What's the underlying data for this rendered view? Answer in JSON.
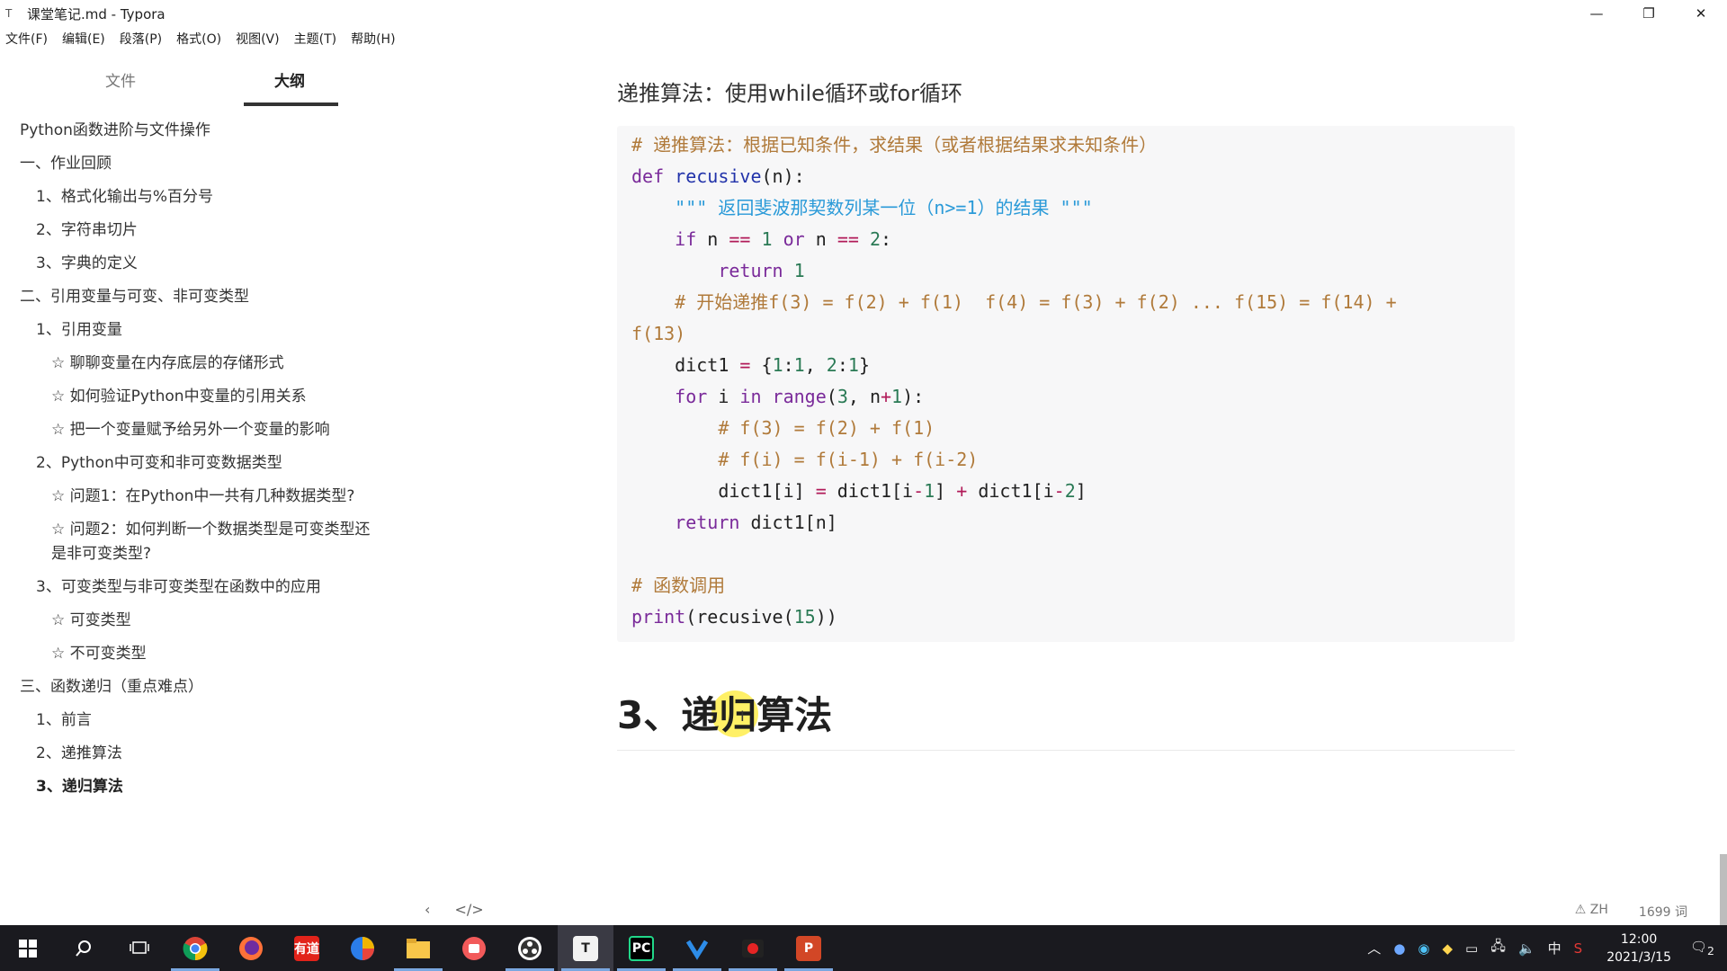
{
  "window": {
    "title": "课堂笔记.md - Typora",
    "app_icon": "T",
    "minimize": "—",
    "restore": "❐",
    "close": "✕"
  },
  "menu": [
    "文件(F)",
    "编辑(E)",
    "段落(P)",
    "格式(O)",
    "视图(V)",
    "主题(T)",
    "帮助(H)"
  ],
  "sidebar": {
    "tab_files": "文件",
    "tab_outline": "大纲",
    "outline": [
      "Python函数进阶与文件操作",
      "一、作业回顾",
      "1、格式化输出与%百分号",
      "2、字符串切片",
      "3、字典的定义",
      "二、引用变量与可变、非可变类型",
      "1、引用变量",
      "☆ 聊聊变量在内存底层的存储形式",
      "☆ 如何验证Python中变量的引用关系",
      "☆ 把一个变量赋予给另外一个变量的影响",
      "2、Python中可变和非可变数据类型",
      "☆ 问题1：在Python中一共有几种数据类型?",
      "☆ 问题2：如何判断一个数据类型是可变类型还是非可变类型?",
      "3、可变类型与非可变类型在函数中的应用",
      "☆ 可变类型",
      "☆ 不可变类型",
      "三、函数递归（重点难点）",
      "1、前言",
      "2、递推算法",
      "3、递归算法"
    ]
  },
  "main": {
    "subheading": "递推算法：使用while循环或for循环",
    "code": {
      "l1": "# 递推算法：根据已知条件，求结果（或者根据结果求未知条件）",
      "l2_kw": "def",
      "l2_fn": "recusive",
      "l2_rest": "(n):",
      "l3": "    \"\"\" 返回斐波那契数列某一位（n>=1）的结果 \"\"\"",
      "l4_indent": "    ",
      "l4_kw": "if",
      "l4_a": " n ",
      "l4_op1": "==",
      "l4_sp": " ",
      "l4_n1": "1",
      "l4_or": " or",
      "l4_b": " n ",
      "l4_op2": "==",
      "l4_n2": " 2",
      "l4_c": ":",
      "l5_indent": "        ",
      "l5_kw": "return",
      "l5_n": " 1",
      "l6": "    # 开始递推f(3) = f(2) + f(1)  f(4) = f(3) + f(2) ... f(15) = f(14) +",
      "l7": "f(13)",
      "l8_a": "    dict1 ",
      "l8_op": "=",
      "l8_b": " {",
      "l8_n1": "1",
      "l8_c": ":",
      "l8_n2": "1",
      "l8_d": ", ",
      "l8_n3": "2",
      "l8_e": ":",
      "l8_n4": "1",
      "l8_f": "}",
      "l9_indent": "    ",
      "l9_kw": "for",
      "l9_a": " i ",
      "l9_in": "in",
      "l9_fn": " range",
      "l9_b": "(",
      "l9_n": "3",
      "l9_c": ", n",
      "l9_op": "+",
      "l9_n2": "1",
      "l9_d": "):",
      "l10": "        # f(3) = f(2) + f(1)",
      "l11": "        # f(i) = f(i-1) + f(i-2)",
      "l12_a": "        dict1[i] ",
      "l12_op1": "=",
      "l12_b": " dict1[i",
      "l12_op2": "-",
      "l12_n1": "1",
      "l12_c": "] ",
      "l12_op3": "+",
      "l12_d": " dict1[i",
      "l12_op4": "-",
      "l12_n2": "2",
      "l12_e": "]",
      "l13_indent": "    ",
      "l13_kw": "return",
      "l13_a": " dict1[n]",
      "l14": "# 函数调用",
      "l15_kw": "print",
      "l15_a": "(recusive(",
      "l15_n": "15",
      "l15_b": "))"
    },
    "heading": "3、递归算法",
    "text_cursor": "I"
  },
  "statusbar": {
    "back": "‹",
    "source_toggle": "</>",
    "lang": "⚠ ZH",
    "word_count": "1699 词"
  },
  "taskbar": {
    "icons": [
      "windows-start",
      "search",
      "task-view",
      "chrome",
      "firefox",
      "youdao",
      "color-app",
      "file-explorer",
      "red-app",
      "obs",
      "typora",
      "pycharm",
      "vscode-like",
      "recorder",
      "powerpoint"
    ],
    "youdao_label": "有道",
    "typora_label": "T",
    "pycharm_label": "PC",
    "ppt_label": "P",
    "tray_ime": "中",
    "time": "12:00",
    "date": "2021/3/15",
    "notifications": "2"
  }
}
